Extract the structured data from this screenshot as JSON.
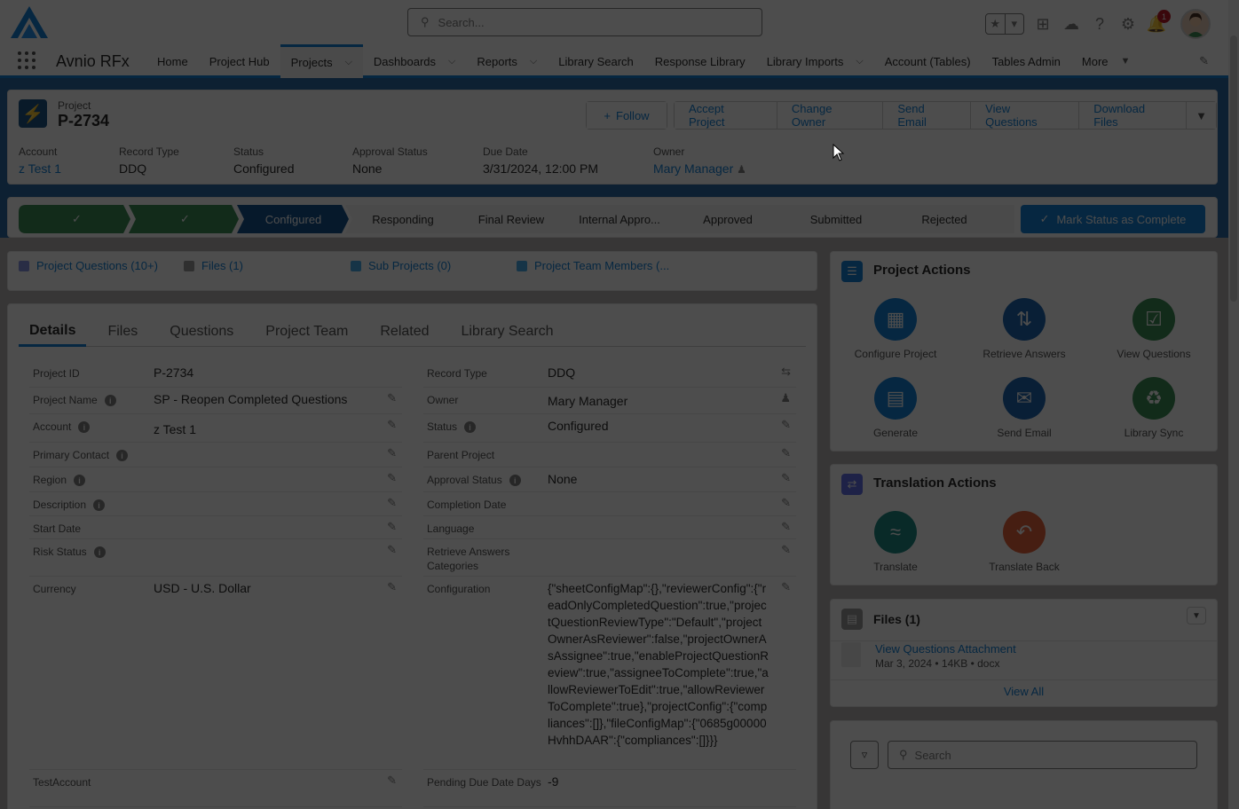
{
  "topbar": {
    "search_placeholder": "Search...",
    "notification_count": "1"
  },
  "nav": {
    "app_name": "Avnio RFx",
    "items": [
      {
        "label": "Home",
        "has_menu": false
      },
      {
        "label": "Project Hub",
        "has_menu": false
      },
      {
        "label": "Projects",
        "has_menu": true
      },
      {
        "label": "Dashboards",
        "has_menu": true
      },
      {
        "label": "Reports",
        "has_menu": true
      },
      {
        "label": "Library Search",
        "has_menu": false
      },
      {
        "label": "Response Library",
        "has_menu": false
      },
      {
        "label": "Library Imports",
        "has_menu": true
      },
      {
        "label": "Account (Tables)",
        "has_menu": false
      },
      {
        "label": "Tables Admin",
        "has_menu": false
      },
      {
        "label": "More",
        "has_menu": true
      }
    ]
  },
  "header": {
    "object_type": "Project",
    "title": "P-2734",
    "buttons": {
      "follow": "Follow",
      "accept": "Accept Project",
      "change_owner": "Change Owner",
      "send_email": "Send Email",
      "view_questions": "View Questions",
      "download_files": "Download Files"
    },
    "fields": {
      "account_label": "Account",
      "account_value": "z Test 1",
      "record_type_label": "Record Type",
      "record_type_value": "DDQ",
      "status_label": "Status",
      "status_value": "Configured",
      "approval_label": "Approval Status",
      "approval_value": "None",
      "due_label": "Due Date",
      "due_value": "3/31/2024, 12:00 PM",
      "owner_label": "Owner",
      "owner_value": "Mary Manager"
    }
  },
  "path": {
    "steps": [
      "",
      "",
      "Configured",
      "Responding",
      "Final Review",
      "Internal Appro...",
      "Approved",
      "Submitted",
      "Rejected"
    ],
    "mark_complete": "Mark Status as Complete"
  },
  "related": {
    "project_questions": "Project Questions (10+)",
    "files": "Files (1)",
    "sub_projects": "Sub Projects (0)",
    "team_members": "Project Team Members (..."
  },
  "tabs": [
    "Details",
    "Files",
    "Questions",
    "Project Team",
    "Related",
    "Library Search"
  ],
  "details": {
    "project_id_label": "Project ID",
    "project_id": "P-2734",
    "project_name_label": "Project Name",
    "project_name": "SP - Reopen Completed Questions",
    "account_label": "Account",
    "account": "z Test 1",
    "primary_contact_label": "Primary Contact",
    "region_label": "Region",
    "description_label": "Description",
    "start_date_label": "Start Date",
    "risk_status_label": "Risk Status",
    "currency_label": "Currency",
    "currency": "USD - U.S. Dollar",
    "testaccount_label": "TestAccount",
    "record_type_label": "Record Type",
    "record_type": "DDQ",
    "owner_label": "Owner",
    "owner": "Mary Manager",
    "status_label": "Status",
    "status": "Configured",
    "parent_project_label": "Parent Project",
    "approval_status_label": "Approval Status",
    "approval_status": "None",
    "completion_date_label": "Completion Date",
    "language_label": "Language",
    "retrieve_categories_label": "Retrieve Answers Categories",
    "configuration_label": "Configuration",
    "configuration": "{\"sheetConfigMap\":{},\"reviewerConfig\":{\"readOnlyCompletedQuestion\":true,\"projectQuestionReviewType\":\"Default\",\"projectOwnerAsReviewer\":false,\"projectOwnerAsAssignee\":true,\"enableProjectQuestionReview\":true,\"assigneeToComplete\":true,\"allowReviewerToEdit\":true,\"allowReviewerToComplete\":true},\"projectConfig\":{\"compliances\":[]},\"fileConfigMap\":{\"0685g00000HvhhDAAR\":{\"compliances\":[]}}}",
    "pending_due_label": "Pending Due Date Days",
    "pending_due": "-9"
  },
  "project_actions": {
    "title": "Project Actions",
    "items": [
      "Configure Project",
      "Retrieve Answers",
      "View Questions",
      "Generate",
      "Send Email",
      "Library Sync"
    ]
  },
  "translation_actions": {
    "title": "Translation Actions",
    "items": [
      "Translate",
      "Translate Back"
    ]
  },
  "files_card": {
    "title": "Files (1)",
    "file_name": "View Questions Attachment",
    "file_meta": "Mar 3, 2024 • 14KB • docx",
    "view_all": "View All"
  },
  "search_card": {
    "placeholder": "Search"
  }
}
